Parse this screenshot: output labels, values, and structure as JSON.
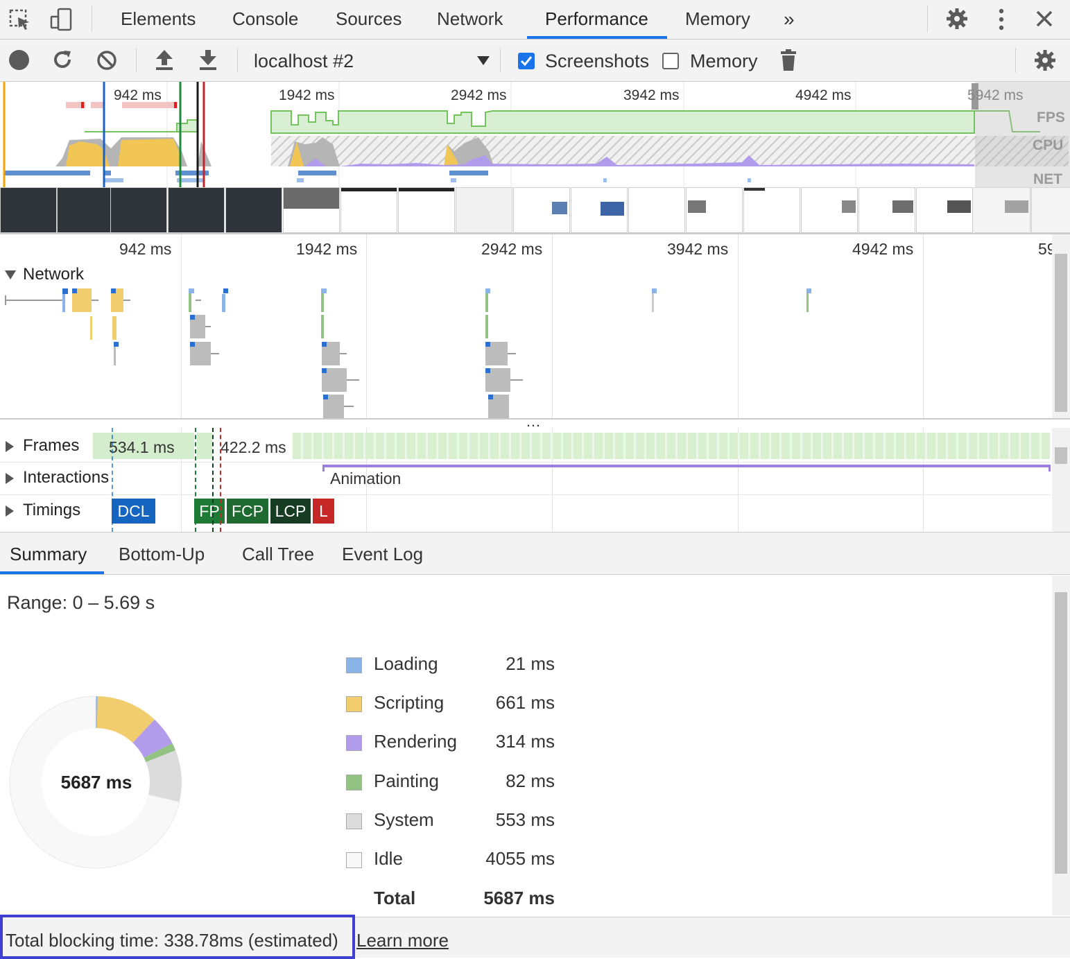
{
  "tabs": [
    "Elements",
    "Console",
    "Sources",
    "Network",
    "Performance",
    "Memory"
  ],
  "tab_active": "Performance",
  "toolbar": {
    "profile_select": "localhost #2",
    "screenshots_label": "Screenshots",
    "screenshots_checked": true,
    "memory_label": "Memory",
    "memory_checked": false
  },
  "overview": {
    "time_labels": [
      "942 ms",
      "1942 ms",
      "2942 ms",
      "3942 ms",
      "4942 ms",
      "5942 ms"
    ],
    "lanes": [
      "FPS",
      "CPU",
      "NET"
    ]
  },
  "main": {
    "time_labels": [
      "942 ms",
      "1942 ms",
      "2942 ms",
      "3942 ms",
      "4942 ms",
      "59"
    ],
    "network_label": "Network"
  },
  "tracks": {
    "frames_label": "Frames",
    "frame1": "534.1 ms",
    "frame2": "422.2 ms",
    "interactions_label": "Interactions",
    "animation_label": "Animation",
    "timings_label": "Timings",
    "timings": [
      "DCL",
      "FP",
      "FCP",
      "LCP",
      "L"
    ]
  },
  "bottom_tabs": [
    "Summary",
    "Bottom-Up",
    "Call Tree",
    "Event Log"
  ],
  "bottom_tab_active": "Summary",
  "summary": {
    "range": "Range: 0 – 5.69 s",
    "total_center": "5687 ms",
    "rows": [
      {
        "value": "21 ms",
        "label": "Loading",
        "ms": 21,
        "color": "#8ab4e8"
      },
      {
        "value": "661 ms",
        "label": "Scripting",
        "ms": 661,
        "color": "#f2cd6e"
      },
      {
        "value": "314 ms",
        "label": "Rendering",
        "ms": 314,
        "color": "#b19ceb"
      },
      {
        "value": "82 ms",
        "label": "Painting",
        "ms": 82,
        "color": "#93c383"
      },
      {
        "value": "553 ms",
        "label": "System",
        "ms": 553,
        "color": "#dcdcdc"
      },
      {
        "value": "4055 ms",
        "label": "Idle",
        "ms": 4055,
        "color": "#f8f8f8"
      }
    ],
    "total_value": "5687 ms",
    "total_label": "Total"
  },
  "status": {
    "blocking_text": "Total blocking time: 338.78ms (estimated)",
    "learn_more": "Learn more"
  },
  "colors": {
    "accent": "#1a73e8",
    "highlight_box": "#3f3fd1",
    "fps_green": "#c9eac0",
    "scripting": "#f2cd6e",
    "rendering": "#b19ceb"
  }
}
